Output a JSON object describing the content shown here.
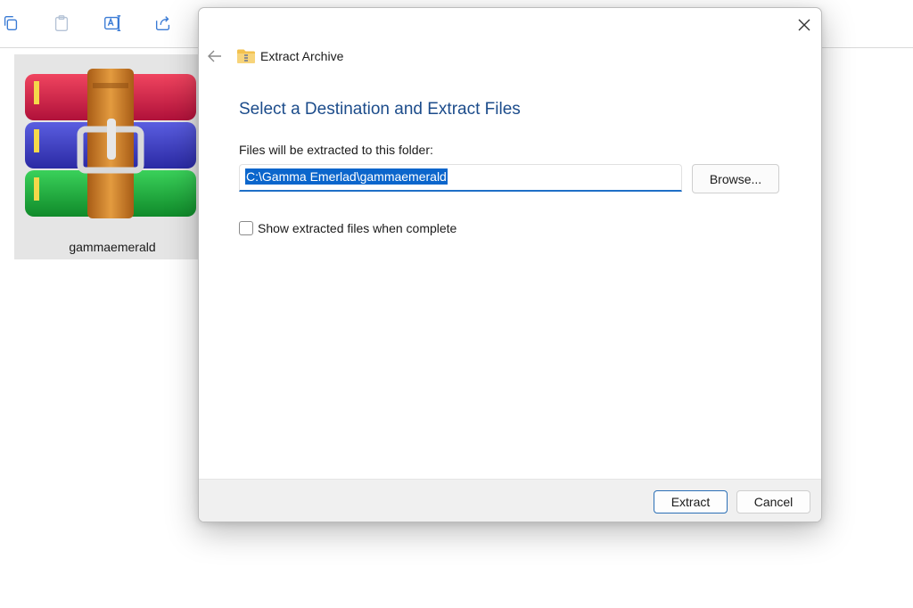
{
  "explorer": {
    "toolbar": {
      "icons": [
        "copy-icon",
        "paste-icon",
        "rename-icon",
        "share-icon"
      ]
    },
    "file": {
      "name": "gammaemerald",
      "icon": "winrar-archive-icon"
    }
  },
  "dialog": {
    "header_title": "Extract Archive",
    "heading": "Select a Destination and Extract Files",
    "destination_label": "Files will be extracted to this folder:",
    "destination_path": "C:\\Gamma Emerlad\\gammaemerald",
    "browse_label": "Browse...",
    "show_files_label": "Show extracted files when complete",
    "show_files_checked": false,
    "extract_label": "Extract",
    "cancel_label": "Cancel"
  },
  "colors": {
    "heading": "#1c4c8b",
    "selection": "#0b66cc",
    "accent": "#1e6fc7",
    "footer": "#f0f0f0"
  }
}
